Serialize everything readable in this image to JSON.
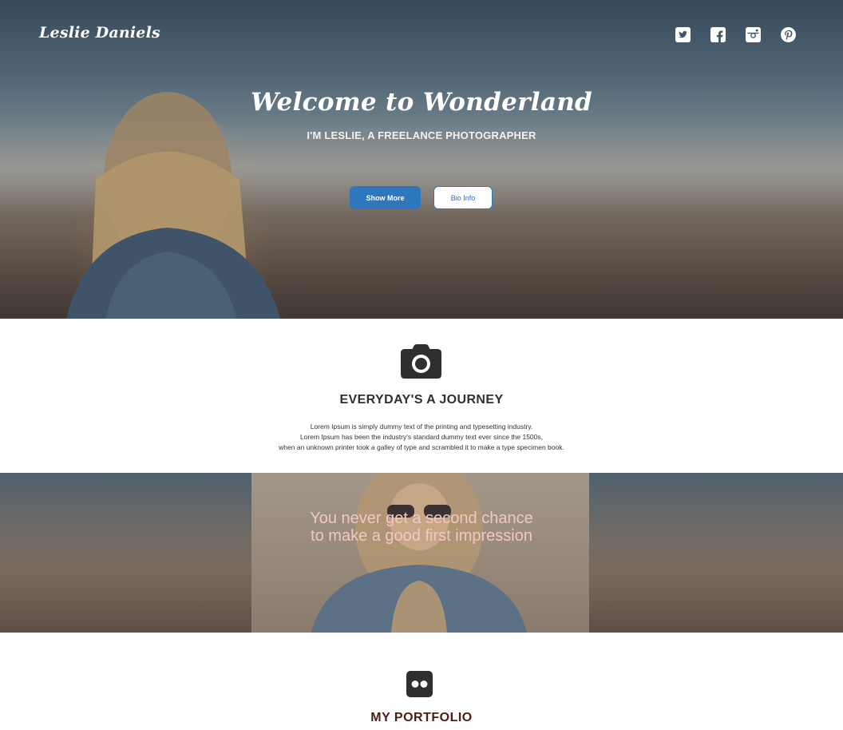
{
  "header": {
    "brand": "Leslie Daniels",
    "social": [
      "twitter-icon",
      "facebook-icon",
      "instagram-icon",
      "pinterest-icon"
    ]
  },
  "hero": {
    "title": "Welcome to Wonderland",
    "subtitle": "I'M LESLIE, A FREELANCE PHOTOGRAPHER",
    "primary_button": "Show More",
    "secondary_button": "Bio Info"
  },
  "journey": {
    "icon": "camera-icon",
    "title": "EVERYDAY'S A JOURNEY",
    "lines": [
      "Lorem Ipsum is simply dummy text of the printing and typesetting industry.",
      "Lorem Ipsum has been the industry's standard dummy text ever since the 1500s,",
      "when an unknown printer took a galley of type and scrambled it to make a type specimen book."
    ]
  },
  "quote": {
    "line1": "You never get a second chance",
    "line2": "to make a good first impression"
  },
  "portfolio": {
    "icon": "flickr-icon",
    "title": "MY PORTFOLIO"
  },
  "colors": {
    "accent": "#2f77bd",
    "quote_text": "#f1c7c3",
    "portfolio_title": "#4d1c18"
  }
}
